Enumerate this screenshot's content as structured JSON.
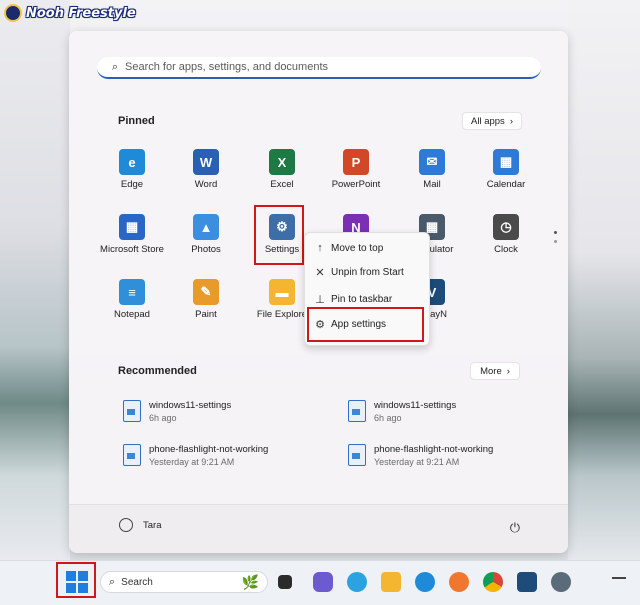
{
  "watermark": {
    "text": "Nooh Freestyle"
  },
  "search": {
    "placeholder": "Search for apps, settings, and documents"
  },
  "pinned": {
    "title": "Pinned",
    "all_apps_label": "All apps",
    "apps": [
      {
        "label": "Edge",
        "icon": "edge-icon",
        "color": "#1f8ad8",
        "glyph": "e"
      },
      {
        "label": "Word",
        "icon": "word-icon",
        "color": "#2b5fb4",
        "glyph": "W"
      },
      {
        "label": "Excel",
        "icon": "excel-icon",
        "color": "#1d7a45",
        "glyph": "X"
      },
      {
        "label": "PowerPoint",
        "icon": "powerpoint-icon",
        "color": "#d24726",
        "glyph": "P"
      },
      {
        "label": "Mail",
        "icon": "mail-icon",
        "color": "#2f7ad6",
        "glyph": "✉"
      },
      {
        "label": "Calendar",
        "icon": "calendar-icon",
        "color": "#2f7ad6",
        "glyph": "▦"
      },
      {
        "label": "Microsoft Store",
        "icon": "store-icon",
        "color": "#2a66c8",
        "glyph": "▦"
      },
      {
        "label": "Photos",
        "icon": "photos-icon",
        "color": "#3b8ee0",
        "glyph": "▲"
      },
      {
        "label": "Settings",
        "icon": "settings-icon",
        "color": "#3e6ea8",
        "glyph": "⚙"
      },
      {
        "label": "OneNote",
        "icon": "onenote-icon",
        "color": "#7b2fb5",
        "glyph": "N"
      },
      {
        "label": "Calculator",
        "icon": "calculator-icon",
        "color": "#4a5a6a",
        "glyph": "▦"
      },
      {
        "label": "Clock",
        "icon": "clock-icon",
        "color": "#4a4a4a",
        "glyph": "◷"
      },
      {
        "label": "Notepad",
        "icon": "notepad-icon",
        "color": "#2f8fd8",
        "glyph": "≡"
      },
      {
        "label": "Paint",
        "icon": "paint-icon",
        "color": "#e89a2a",
        "glyph": "✎"
      },
      {
        "label": "File Explore",
        "icon": "file-explorer-icon",
        "color": "#f4b530",
        "glyph": "▬"
      },
      {
        "label": "",
        "icon": "skype-icon",
        "color": "#2aa3e0",
        "glyph": "S"
      },
      {
        "label": "v2rayN",
        "icon": "v2rayn-icon",
        "color": "#1e4b7a",
        "glyph": "V"
      }
    ]
  },
  "context_menu": {
    "items": [
      {
        "label": "Move to top",
        "icon": "arrow-up-icon"
      },
      {
        "label": "Unpin from Start",
        "icon": "unpin-icon"
      },
      {
        "label": "Pin to taskbar",
        "icon": "pin-icon"
      },
      {
        "label": "App settings",
        "icon": "gear-icon"
      }
    ]
  },
  "recommended": {
    "title": "Recommended",
    "more_label": "More",
    "items": [
      {
        "name": "windows11-settings",
        "time": "6h ago"
      },
      {
        "name": "windows11-settings",
        "time": "6h ago"
      },
      {
        "name": "phone-flashlight-not-working",
        "time": "Yesterday at 9:21 AM"
      },
      {
        "name": "phone-flashlight-not-working",
        "time": "Yesterday at 9:21 AM"
      }
    ]
  },
  "user": {
    "name": "Tara"
  },
  "taskbar": {
    "search_label": "Search",
    "apps": [
      "file-explorer-icon",
      "edge-icon",
      "firefox-icon",
      "chrome-icon",
      "v2rayn-icon",
      "settings-icon"
    ]
  }
}
